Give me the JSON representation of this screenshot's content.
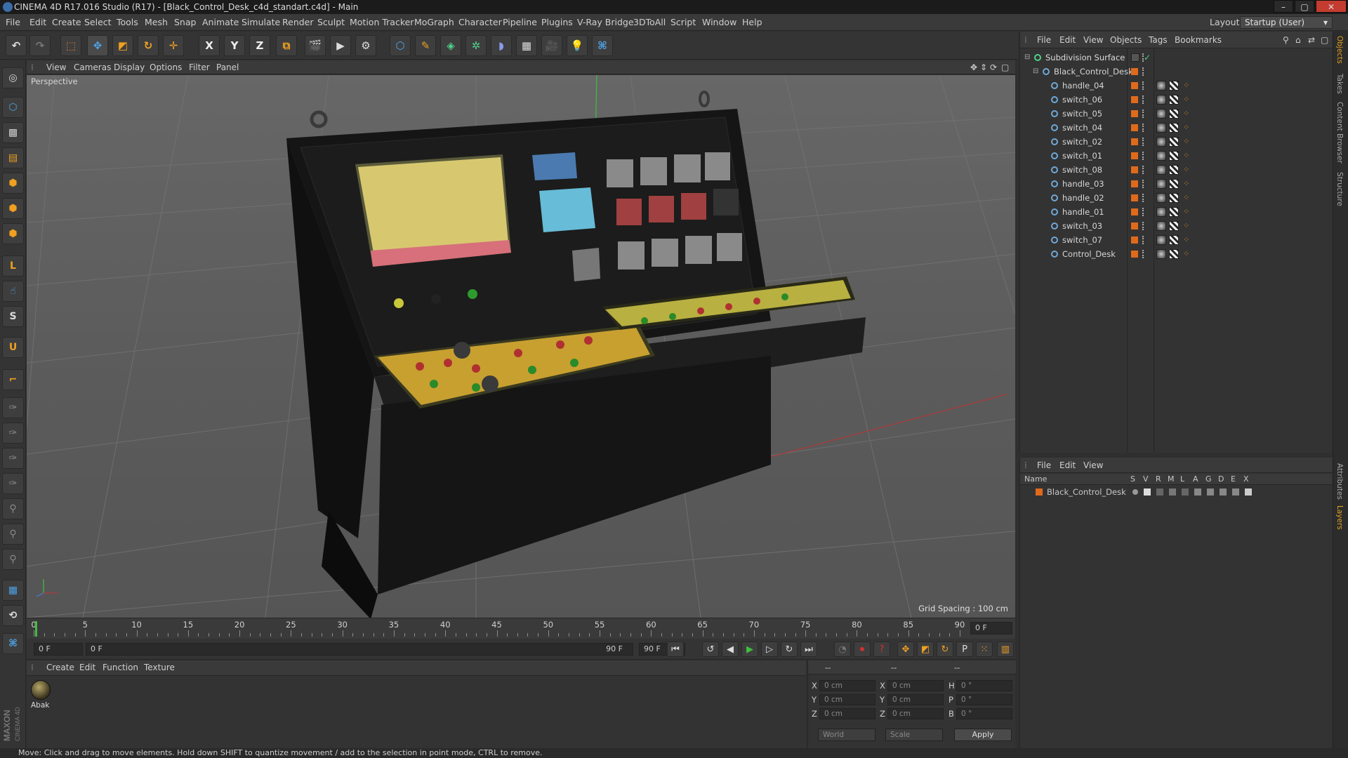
{
  "window": {
    "title": "CINEMA 4D R17.016 Studio (R17) - [Black_Control_Desk_c4d_standart.c4d] - Main"
  },
  "menubar": {
    "items": [
      "File",
      "Edit",
      "Create",
      "Select",
      "Tools",
      "Mesh",
      "Snap",
      "Animate",
      "Simulate",
      "Render",
      "Sculpt",
      "Motion Tracker",
      "MoGraph",
      "Character",
      "Pipeline",
      "Plugins",
      "V-Ray Bridge",
      "3DToAll",
      "Script",
      "Window",
      "Help"
    ],
    "layout_label": "Layout:",
    "layout_value": "Startup (User)"
  },
  "toolbar": {
    "axis_x": "X",
    "axis_y": "Y",
    "axis_z": "Z"
  },
  "viewport": {
    "menu": [
      "View",
      "Cameras",
      "Display",
      "Options",
      "Filter",
      "Panel"
    ],
    "camera": "Perspective",
    "grid_spacing": "Grid Spacing : 100 cm"
  },
  "timeline": {
    "ticks": [
      "0",
      "5",
      "10",
      "15",
      "20",
      "25",
      "30",
      "35",
      "40",
      "45",
      "50",
      "55",
      "60",
      "65",
      "70",
      "75",
      "80",
      "85",
      "90"
    ],
    "current_frame": "0 F"
  },
  "transport": {
    "start": "0 F",
    "range_start": "0 F",
    "range_end": "90 F",
    "end": "90 F"
  },
  "material_panel": {
    "menu": [
      "Create",
      "Edit",
      "Function",
      "Texture"
    ],
    "material_name": "Abak"
  },
  "coordinates": {
    "pos_x": "0 cm",
    "pos_y": "0 cm",
    "pos_z": "0 cm",
    "size_x": "0 cm",
    "size_y": "0 cm",
    "size_z": "0 cm",
    "rot_h": "0 °",
    "rot_p": "0 °",
    "rot_b": "0 °",
    "label_x": "X",
    "label_y": "Y",
    "label_z": "Z",
    "label_h": "H",
    "label_p": "P",
    "label_b": "B",
    "mode_world": "World",
    "mode_scale": "Scale",
    "apply": "Apply",
    "header_a": "--",
    "header_b": "--",
    "header_c": "--"
  },
  "objects_panel": {
    "menu": [
      "File",
      "Edit",
      "View",
      "Objects",
      "Tags",
      "Bookmarks"
    ],
    "items": [
      "Subdivision Surface",
      "Black_Control_Desk",
      "handle_04",
      "switch_06",
      "switch_05",
      "switch_04",
      "switch_02",
      "switch_01",
      "switch_08",
      "handle_03",
      "handle_02",
      "handle_01",
      "switch_03",
      "switch_07",
      "Control_Desk"
    ]
  },
  "layers_panel": {
    "menu": [
      "File",
      "Edit",
      "View"
    ],
    "columns": [
      "Name",
      "S",
      "V",
      "R",
      "M",
      "L",
      "A",
      "G",
      "D",
      "E",
      "X"
    ],
    "row": "Black_Control_Desk"
  },
  "right_tabs": [
    "Objects",
    "Takes",
    "Content Browser",
    "Structure",
    "Attributes",
    "Layers"
  ],
  "brand": {
    "maxon": "MAXON",
    "cinema": "CINEMA 4D"
  },
  "statusbar": {
    "text": "Move: Click and drag to move elements. Hold down SHIFT to quantize movement / add to the selection in point mode, CTRL to remove."
  },
  "colors": {
    "layer_orange": "#e06a1c",
    "accent_blue": "#4a90d9"
  }
}
